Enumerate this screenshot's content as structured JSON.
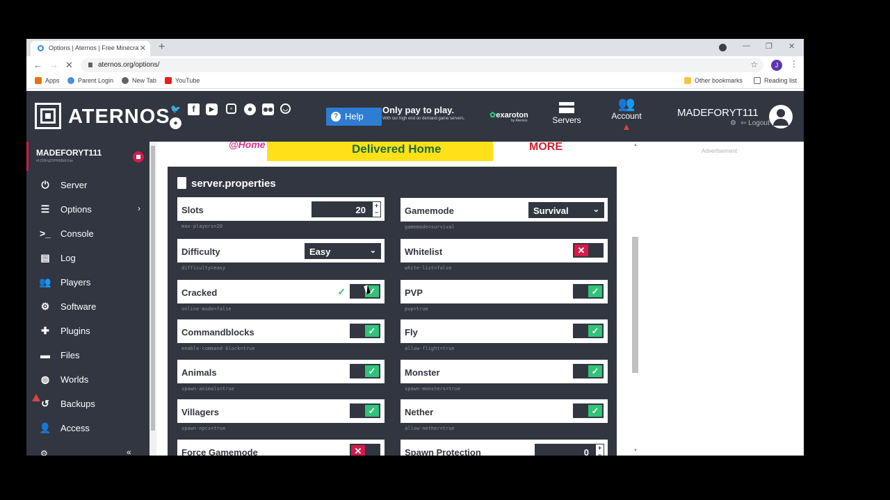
{
  "browser": {
    "tab_title": "Options | Aternos | Free Minecraft",
    "url": "aternos.org/options/",
    "profile_initial": "J",
    "bookmarks": [
      "Apps",
      "Parent Login",
      "New Tab",
      "YouTube"
    ],
    "bookmarks_right": [
      "Other bookmarks",
      "Reading list"
    ]
  },
  "header": {
    "brand": "ATERNOS",
    "help_label": "Help",
    "promo_title": "Only pay to play.",
    "promo_text": "With our high end on demand game servers.",
    "promo_brand": "exaroton",
    "promo_brand_sub": "by Aternos",
    "nav_servers": "Servers",
    "nav_account": "Account",
    "username": "MADEFORYT111",
    "logout": "Logout"
  },
  "sidebar": {
    "server_name": "MADEFORYT111",
    "server_id": "#LODFq2OPHEBdh1ne",
    "items": [
      {
        "label": "Server",
        "icon": "power-icon"
      },
      {
        "label": "Options",
        "icon": "sliders-icon"
      },
      {
        "label": "Console",
        "icon": "terminal-icon"
      },
      {
        "label": "Log",
        "icon": "file-icon"
      },
      {
        "label": "Players",
        "icon": "users-icon"
      },
      {
        "label": "Software",
        "icon": "gears-icon"
      },
      {
        "label": "Plugins",
        "icon": "puzzle-icon"
      },
      {
        "label": "Files",
        "icon": "folder-icon"
      },
      {
        "label": "Worlds",
        "icon": "globe-icon"
      },
      {
        "label": "Backups",
        "icon": "history-icon"
      },
      {
        "label": "Access",
        "icon": "user-lock-icon"
      }
    ]
  },
  "ad": {
    "home": "@Home",
    "main": "Delivered Home",
    "more": "MORE",
    "label": "Advertisement"
  },
  "panel": {
    "title": "server.properties",
    "options": [
      {
        "name": "Slots",
        "key": "max-players=20",
        "type": "number",
        "value": "20"
      },
      {
        "name": "Gamemode",
        "key": "gamemode=survival",
        "type": "select",
        "value": "Survival"
      },
      {
        "name": "Difficulty",
        "key": "difficulty=easy",
        "type": "select",
        "value": "Easy"
      },
      {
        "name": "Whitelist",
        "key": "white-list=false",
        "type": "toggle",
        "value": false
      },
      {
        "name": "Cracked",
        "key": "online-mode=false",
        "type": "toggle",
        "value": true
      },
      {
        "name": "PVP",
        "key": "pvp=true",
        "type": "toggle",
        "value": true
      },
      {
        "name": "Commandblocks",
        "key": "enable-command-block=true",
        "type": "toggle",
        "value": true
      },
      {
        "name": "Fly",
        "key": "allow-flight=true",
        "type": "toggle",
        "value": true
      },
      {
        "name": "Animals",
        "key": "spawn-animals=true",
        "type": "toggle",
        "value": true
      },
      {
        "name": "Monster",
        "key": "spawn-monsters=true",
        "type": "toggle",
        "value": true
      },
      {
        "name": "Villagers",
        "key": "spawn-npcs=true",
        "type": "toggle",
        "value": true
      },
      {
        "name": "Nether",
        "key": "allow-nether=true",
        "type": "toggle",
        "value": true
      },
      {
        "name": "Force Gamemode",
        "key": "",
        "type": "toggle",
        "value": false
      },
      {
        "name": "Spawn Protection",
        "key": "",
        "type": "number",
        "value": "0"
      }
    ]
  },
  "colors": {
    "dark": "#313640",
    "accent_red": "#d61a4a",
    "toggle_on": "#31c37a",
    "help_blue": "#2d7dd2"
  }
}
